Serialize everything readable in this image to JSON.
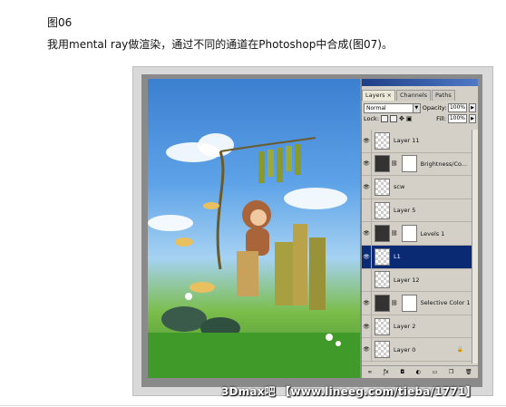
{
  "caption": {
    "figure_label": "图06",
    "text": "我用mental ray做渲染，通过不同的通道在Photoshop中合成(图07)。"
  },
  "layers_panel": {
    "tabs": [
      {
        "label": "Layers",
        "close": "×"
      },
      {
        "label": "Channels"
      },
      {
        "label": "Paths"
      }
    ],
    "blend_mode": "Normal",
    "opacity_label": "Opacity:",
    "opacity_value": "100%",
    "lock_label": "Lock:",
    "fill_label": "Fill:",
    "fill_value": "100%",
    "layers": [
      {
        "name": "Layer 11",
        "visible": true,
        "thumb": "checker",
        "mask": false
      },
      {
        "name": "Brightness/Co...",
        "visible": true,
        "thumb": "adj",
        "mask": true
      },
      {
        "name": "scw",
        "visible": true,
        "thumb": "checker",
        "mask": false
      },
      {
        "name": "Layer 5",
        "visible": false,
        "thumb": "checker",
        "mask": false
      },
      {
        "name": "Levels 1",
        "visible": true,
        "thumb": "adj",
        "mask": true
      },
      {
        "name": "L1",
        "visible": true,
        "thumb": "checker",
        "mask": false,
        "selected": true
      },
      {
        "name": "Layer 12",
        "visible": false,
        "thumb": "checker",
        "mask": false
      },
      {
        "name": "Selective Color 1",
        "visible": true,
        "thumb": "adj",
        "mask": true
      },
      {
        "name": "Layer 2",
        "visible": true,
        "thumb": "checker",
        "mask": false
      },
      {
        "name": "Layer 0",
        "visible": true,
        "thumb": "checker",
        "mask": false,
        "locked": true
      }
    ],
    "bottom_icons": [
      "link-icon",
      "fx-icon",
      "mask-icon",
      "adjustment-icon",
      "group-icon",
      "new-layer-icon",
      "trash-icon"
    ]
  },
  "watermark": "3Dmax吧 【www.lineeg.com/tieba/1771】"
}
